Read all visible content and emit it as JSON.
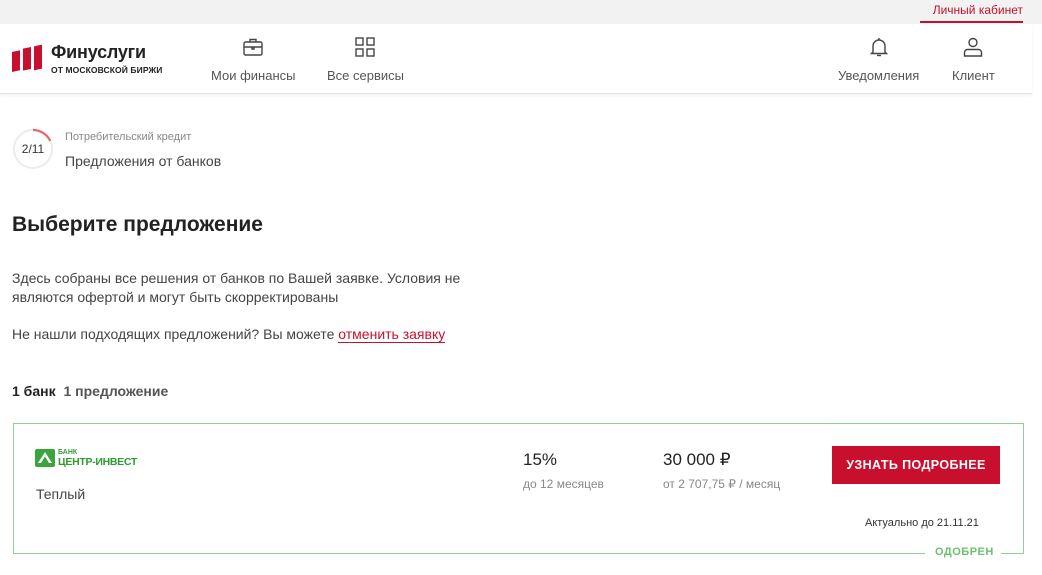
{
  "topbar": {
    "account_link": "Личный кабинет"
  },
  "header": {
    "logo_title": "Финуслуги",
    "logo_subtitle": "ОТ МОСКОВСКОЙ БИРЖИ",
    "nav": {
      "finances": "Мои финансы",
      "services": "Все сервисы",
      "notifications": "Уведомления",
      "client": "Клиент"
    }
  },
  "step": {
    "progress_text": "2/11",
    "progress_fraction": 0.18,
    "category": "Потребительский кредит",
    "title": "Предложения от банков"
  },
  "main": {
    "title": "Выберите предложение",
    "description": "Здесь собраны все решения от банков по Вашей заявке. Условия не являются офертой и могут быть скорректированы",
    "cancel_text": "Не нашли подходящих предложений? Вы можете ",
    "cancel_link": "отменить заявку",
    "bank_count": "1 банк",
    "offer_count": "1 предложение"
  },
  "offer": {
    "bank_name_small": "БАНК",
    "bank_name_big": "ЦЕНТР-ИНВЕСТ",
    "product": "Теплый",
    "rate": "15%",
    "term": "до 12 месяцев",
    "amount": "30 000 ₽",
    "payment": "от 2 707,75 ₽ / месяц",
    "button": "УЗНАТЬ ПОДРОБНЕЕ",
    "valid_until": "Актуально до 21.11.21",
    "status": "ОДОБРЕН"
  },
  "colors": {
    "accent": "#c8102e",
    "approved": "#6cc070",
    "bank_green": "#2f9a2f"
  }
}
